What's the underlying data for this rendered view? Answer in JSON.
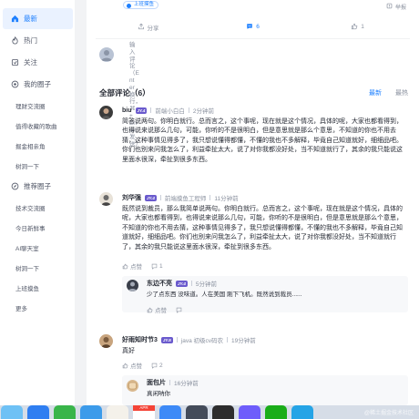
{
  "sidebar": {
    "items": [
      {
        "label": "最新",
        "icon": "home-icon",
        "active": true
      },
      {
        "label": "热门",
        "icon": "fire-icon"
      },
      {
        "label": "关注",
        "icon": "follow-icon"
      },
      {
        "label": "我的圈子",
        "icon": "circle-icon"
      }
    ],
    "my_circles": [
      "理财交流圈",
      "值得收藏的歌曲",
      "掘金相亲角",
      "树洞一下"
    ],
    "recommend_label": "推荐圈子",
    "recommend": [
      "技术交流圈",
      "今日新鲜事",
      "AI聊天室",
      "树洞一下",
      "上班摸鱼",
      "更多"
    ]
  },
  "post": {
    "tag": "上班摸鱼",
    "report": "举报",
    "share": "分享",
    "comment_count": "6",
    "like_count": "1"
  },
  "input": {
    "placeholder": "输入评论（Enter换行，⌘+Enter发送）"
  },
  "comments": {
    "title": "全部评论（6）",
    "sort_latest": "最新",
    "sort_hot": "最热",
    "like_label": "点赞",
    "items": [
      {
        "name": "biu",
        "level": "JY.4",
        "title": "前端小白白",
        "time": "2分钟前",
        "text": "简答说两句。你明白就行。总而言之，这个事呢，现在就是这个情况，具体的呢，大家也都看得到，也得说来说那么几句，可能，你听的不是很明白，但是意思就是那么个意思，不知道的你也不用去猜，这种事情见得多了，我只想说懂得都懂，不懂的我也不多解释，毕竟自己知道就好，细细品吧。你们也别来问我怎么了，利益牵扯太大，说了对你我都没好处，当不知道就行了，其余的我只能说这里面水很深，牵扯到很多东西。",
        "reply_count": ""
      },
      {
        "name": "刘华强",
        "level": "JY.4",
        "title": "前端摸鱼工程师",
        "time": "11分钟前",
        "text": "既然说到裁员，那么我简单说两句。你明白就行。总而言之，这个事呢，现在就是这个情况，具体的呢，大家也都看得到，也得说来说那么几句，可能，你听的不是很明白，但是意思就是那么个意思，不知道的你也不用去猜，这种事情见得多了，我只想说懂得都懂，不懂的我也不多解释，毕竟自己知道就好，细细品吧。你们也别来问我怎么了，利益牵扯太大，说了对你我都没好处，当不知道就行了，其余的我只能说这里面水很深，牵扯到很多东西。",
        "reply_count": "1",
        "reply": {
          "name": "东边不亮",
          "level": "JY.4",
          "time": "5分钟前",
          "text": "少了点东西 没味道。人在美国 刚下飞机。既然说到裁员......"
        }
      },
      {
        "name": "好雨知时节3",
        "level": "JY.5",
        "title": "java 初级cv码农",
        "time": "19分钟前",
        "text": "真好",
        "reply_count": "2",
        "reply": {
          "name": "面包片",
          "level": "",
          "time": "16分钟前",
          "text": "真闲呐你"
        }
      }
    ]
  },
  "dock": {
    "calendar_month": "APR",
    "watermark": "@稀土掘金技术社区"
  },
  "colors": {
    "accent": "#1e80ff",
    "level_badge": "#6a5acd"
  }
}
